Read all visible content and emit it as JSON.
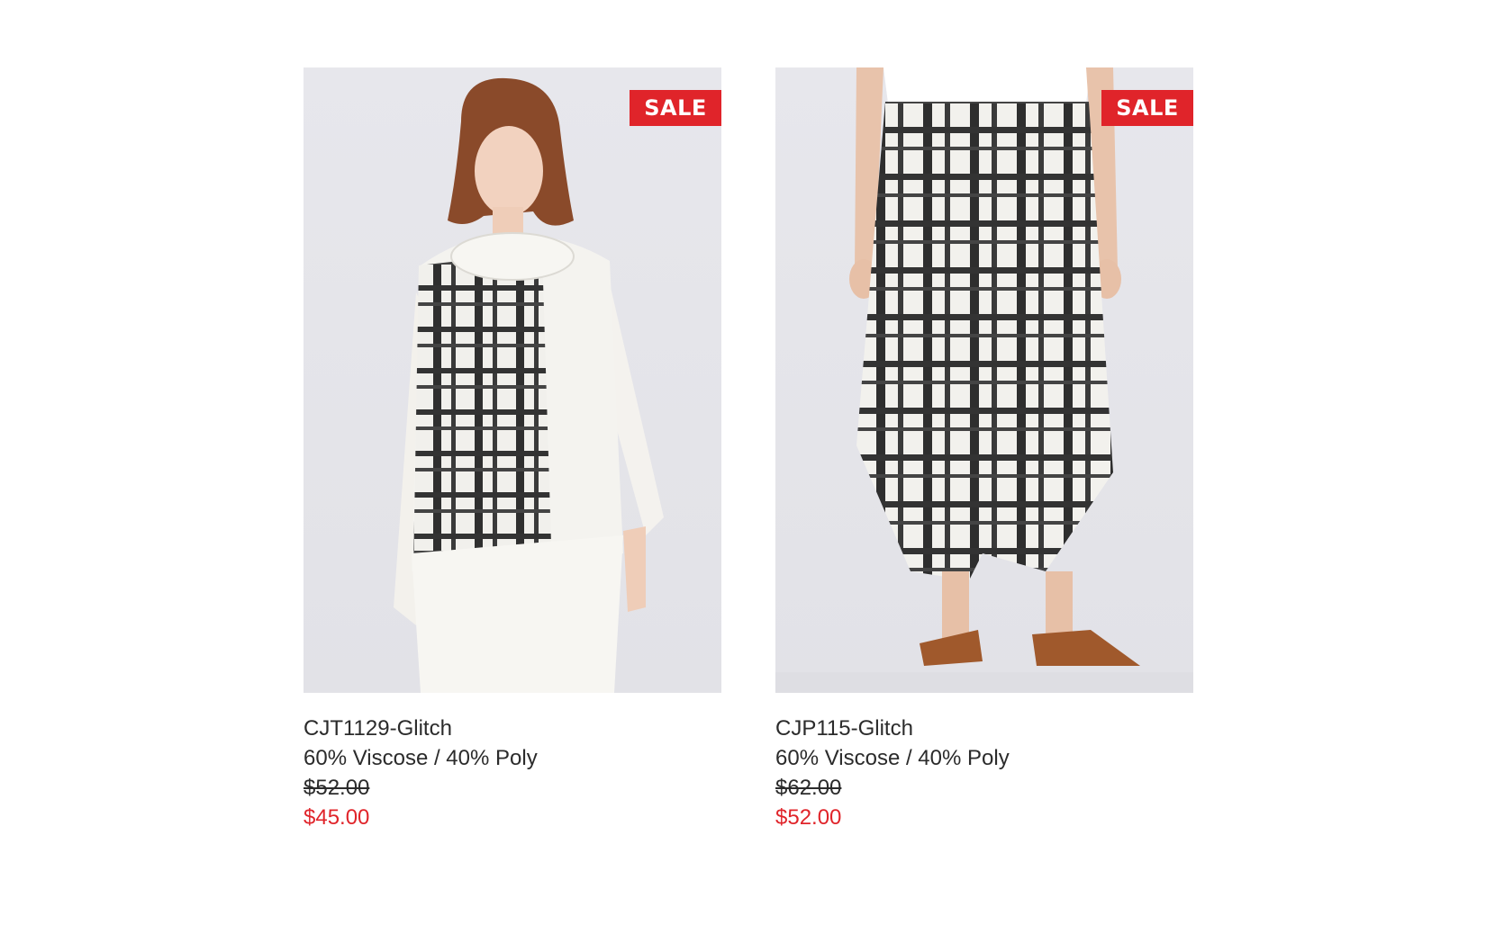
{
  "products": [
    {
      "image_alt": "",
      "badge": "SALE",
      "title": "CJT1129-Glitch",
      "material": "60% Viscose / 40% Poly",
      "original_price": "$52.00",
      "sale_price": "$45.00"
    },
    {
      "image_alt": "",
      "badge": "SALE",
      "title": "CJP115-Glitch",
      "material": "60% Viscose / 40% Poly",
      "original_price": "$62.00",
      "sale_price": "$52.00"
    }
  ],
  "colors": {
    "sale_red": "#e0242a",
    "text": "#2b2b2b",
    "image_bg": "#e5e5ea"
  }
}
